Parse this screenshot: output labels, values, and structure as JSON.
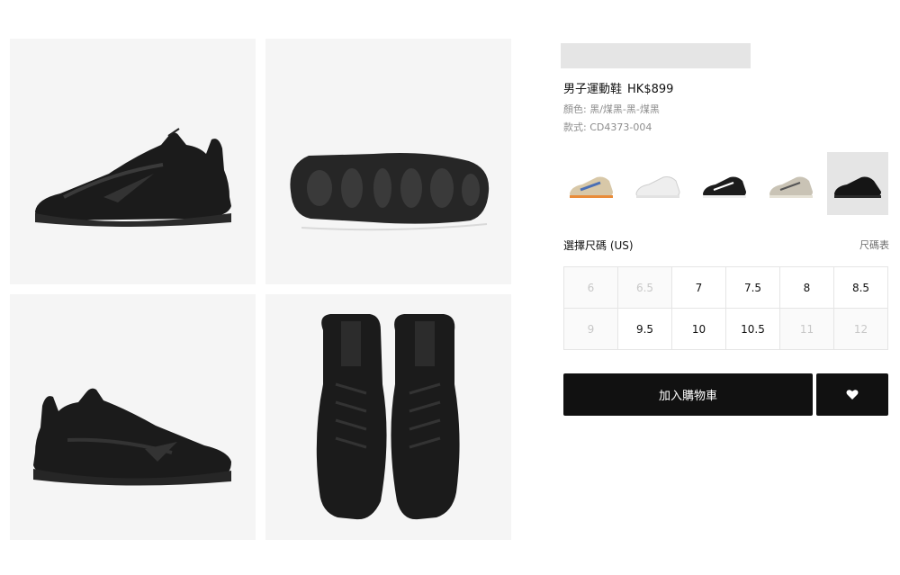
{
  "product": {
    "name": "男子運動鞋",
    "price": "HK$899",
    "color_line": "顏色: 黑/煤黑-黑-煤黑",
    "style_line": "款式: CD4373-004"
  },
  "colors": {
    "shoe": "#1a1a1a",
    "accent": "#111111",
    "panel": "#f5f5f5",
    "placeholder": "#e5e5e5"
  },
  "variants": [
    {
      "name": "multicolor-variant",
      "selected": false
    },
    {
      "name": "white-variant",
      "selected": false
    },
    {
      "name": "black-white-variant",
      "selected": false
    },
    {
      "name": "grey-variant",
      "selected": false
    },
    {
      "name": "black-variant",
      "selected": true
    }
  ],
  "size_section": {
    "label": "選擇尺碼 (US)",
    "guide": "尺碼表"
  },
  "sizes": [
    {
      "label": "6",
      "available": false
    },
    {
      "label": "6.5",
      "available": false
    },
    {
      "label": "7",
      "available": true
    },
    {
      "label": "7.5",
      "available": true
    },
    {
      "label": "8",
      "available": true
    },
    {
      "label": "8.5",
      "available": true
    },
    {
      "label": "9",
      "available": false
    },
    {
      "label": "9.5",
      "available": true
    },
    {
      "label": "10",
      "available": true
    },
    {
      "label": "10.5",
      "available": true
    },
    {
      "label": "11",
      "available": false
    },
    {
      "label": "12",
      "available": false
    }
  ],
  "actions": {
    "add_to_cart": "加入購物車",
    "favorite_icon": "heart-icon"
  }
}
